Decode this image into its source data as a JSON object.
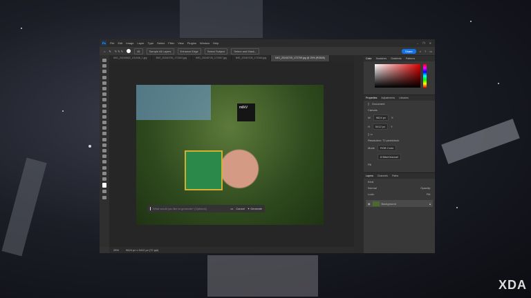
{
  "app": {
    "logo": "Ps",
    "menu": [
      "File",
      "Edit",
      "Image",
      "Layer",
      "Type",
      "Select",
      "Filter",
      "View",
      "Plugins",
      "Window",
      "Help"
    ],
    "window_controls": [
      "–",
      "❐",
      "✕"
    ]
  },
  "options": {
    "size": "45",
    "sample_all_layers": "Sample All Layers",
    "enhance_edge": "Enhance Edge",
    "select_subject": "Select Subject",
    "select_and_mask": "Select and Mask...",
    "share": "Share"
  },
  "tabs": [
    "IMG_20240602_101548_1.jpg",
    "IMG_20240726_171541.jpg",
    "IMG_20240726_171507.jpg",
    "IMG_20240726_171544.jpg",
    "IMG_20240729_172759.jpg @ 25% (RGB/8)"
  ],
  "canvas": {
    "photo_label": "milkV",
    "generate_placeholder": "What would you like to generate? (Optional)",
    "more": "•••",
    "cancel": "Cancel",
    "generate": "Generate"
  },
  "status": {
    "zoom": "25%",
    "doc": "9624 px x 5412 px (72 ppi)"
  },
  "color_panel": {
    "tabs": [
      "Color",
      "Swatches",
      "Gradients",
      "Patterns"
    ]
  },
  "properties": {
    "tabs": [
      "Properties",
      "Adjustments",
      "Libraries"
    ],
    "doc_label": "Document",
    "section": "Canvas",
    "w_label": "W",
    "w": "9624 px",
    "h_label": "H",
    "h": "5412 px",
    "x_label": "X",
    "y_label": "Y",
    "resolution": "Resolution: 72 pixels/inch",
    "mode_label": "Mode",
    "mode": "RGB Color",
    "depth": "8 Bits/Channel",
    "fill_label": "Fill"
  },
  "layers": {
    "tabs": [
      "Layers",
      "Channels",
      "Paths"
    ],
    "kind": "Kind",
    "mode": "Normal",
    "opacity_label": "Opacity:",
    "lock_label": "Lock:",
    "fill_label": "Fill:",
    "items": [
      {
        "name": "Background"
      }
    ]
  },
  "watermark": "XDA"
}
